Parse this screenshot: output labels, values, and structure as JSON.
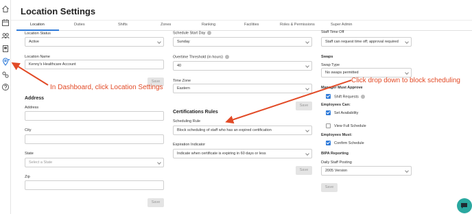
{
  "page_title": "Location Settings",
  "sidebar": {
    "items": [
      "home-icon",
      "calendar-icon",
      "users-icon",
      "clipboard-icon",
      "location-icon",
      "link-icon",
      "help-icon"
    ]
  },
  "tabs": [
    "Location",
    "Duties",
    "Shifts",
    "Zones",
    "Ranking",
    "Facilities",
    "Roles & Permissions",
    "Super Admin"
  ],
  "col1": {
    "location_status_label": "Location Status",
    "location_status_value": "Active",
    "location_name_label": "Location Name",
    "location_name_value": "Kenny's Healthcare Account",
    "save1": "Save",
    "address_title": "Address",
    "address_label": "Address",
    "city_label": "City",
    "state_label": "State",
    "state_placeholder": "Select a State",
    "zip_label": "Zip",
    "save2": "Save"
  },
  "col2": {
    "schedule_start_label": "Schedule Start Day",
    "schedule_start_value": "Sunday",
    "overtime_label": "Overtime Threshold (in hours)",
    "overtime_value": "40",
    "timezone_label": "Time Zone",
    "timezone_value": "Eastern",
    "save1": "Save",
    "cert_title": "Certifications Rules",
    "scheduling_rule_label": "Scheduling Rule",
    "scheduling_rule_value": "Block scheduling of staff who has an expired certification",
    "expiration_label": "Expiration Indicator",
    "expiration_value": "Indicate when certificate is expiring in 60 days or less",
    "save2": "Save"
  },
  "col3": {
    "staff_time_off_label": "Staff Time Off",
    "staff_time_off_value": "Staff can request time off; approval required",
    "swaps_title": "Swaps",
    "swap_type_label": "Swap Type",
    "swap_type_value": "No swaps permitted",
    "manager_approve_title": "Manager Must Approve",
    "shift_requests_label": "Shift Requests",
    "employees_can_title": "Employees Can:",
    "set_availability_label": "Set Availability",
    "view_full_schedule_label": "View Full Schedule",
    "employees_must_title": "Employees Must:",
    "confirm_schedule_label": "Confirm Schedule",
    "bipa_title": "BIPA Reporting",
    "daily_staff_label": "Daily Staff Posting",
    "daily_staff_value": "2005 Version",
    "save": "Save"
  },
  "annotations": {
    "left": "In Dashboard, click Location Settings",
    "right": "Click drop down to block scheduling"
  },
  "colors": {
    "accent": "#2f7bd9",
    "annotation": "#e24a26",
    "chat": "#2aa8a0"
  }
}
